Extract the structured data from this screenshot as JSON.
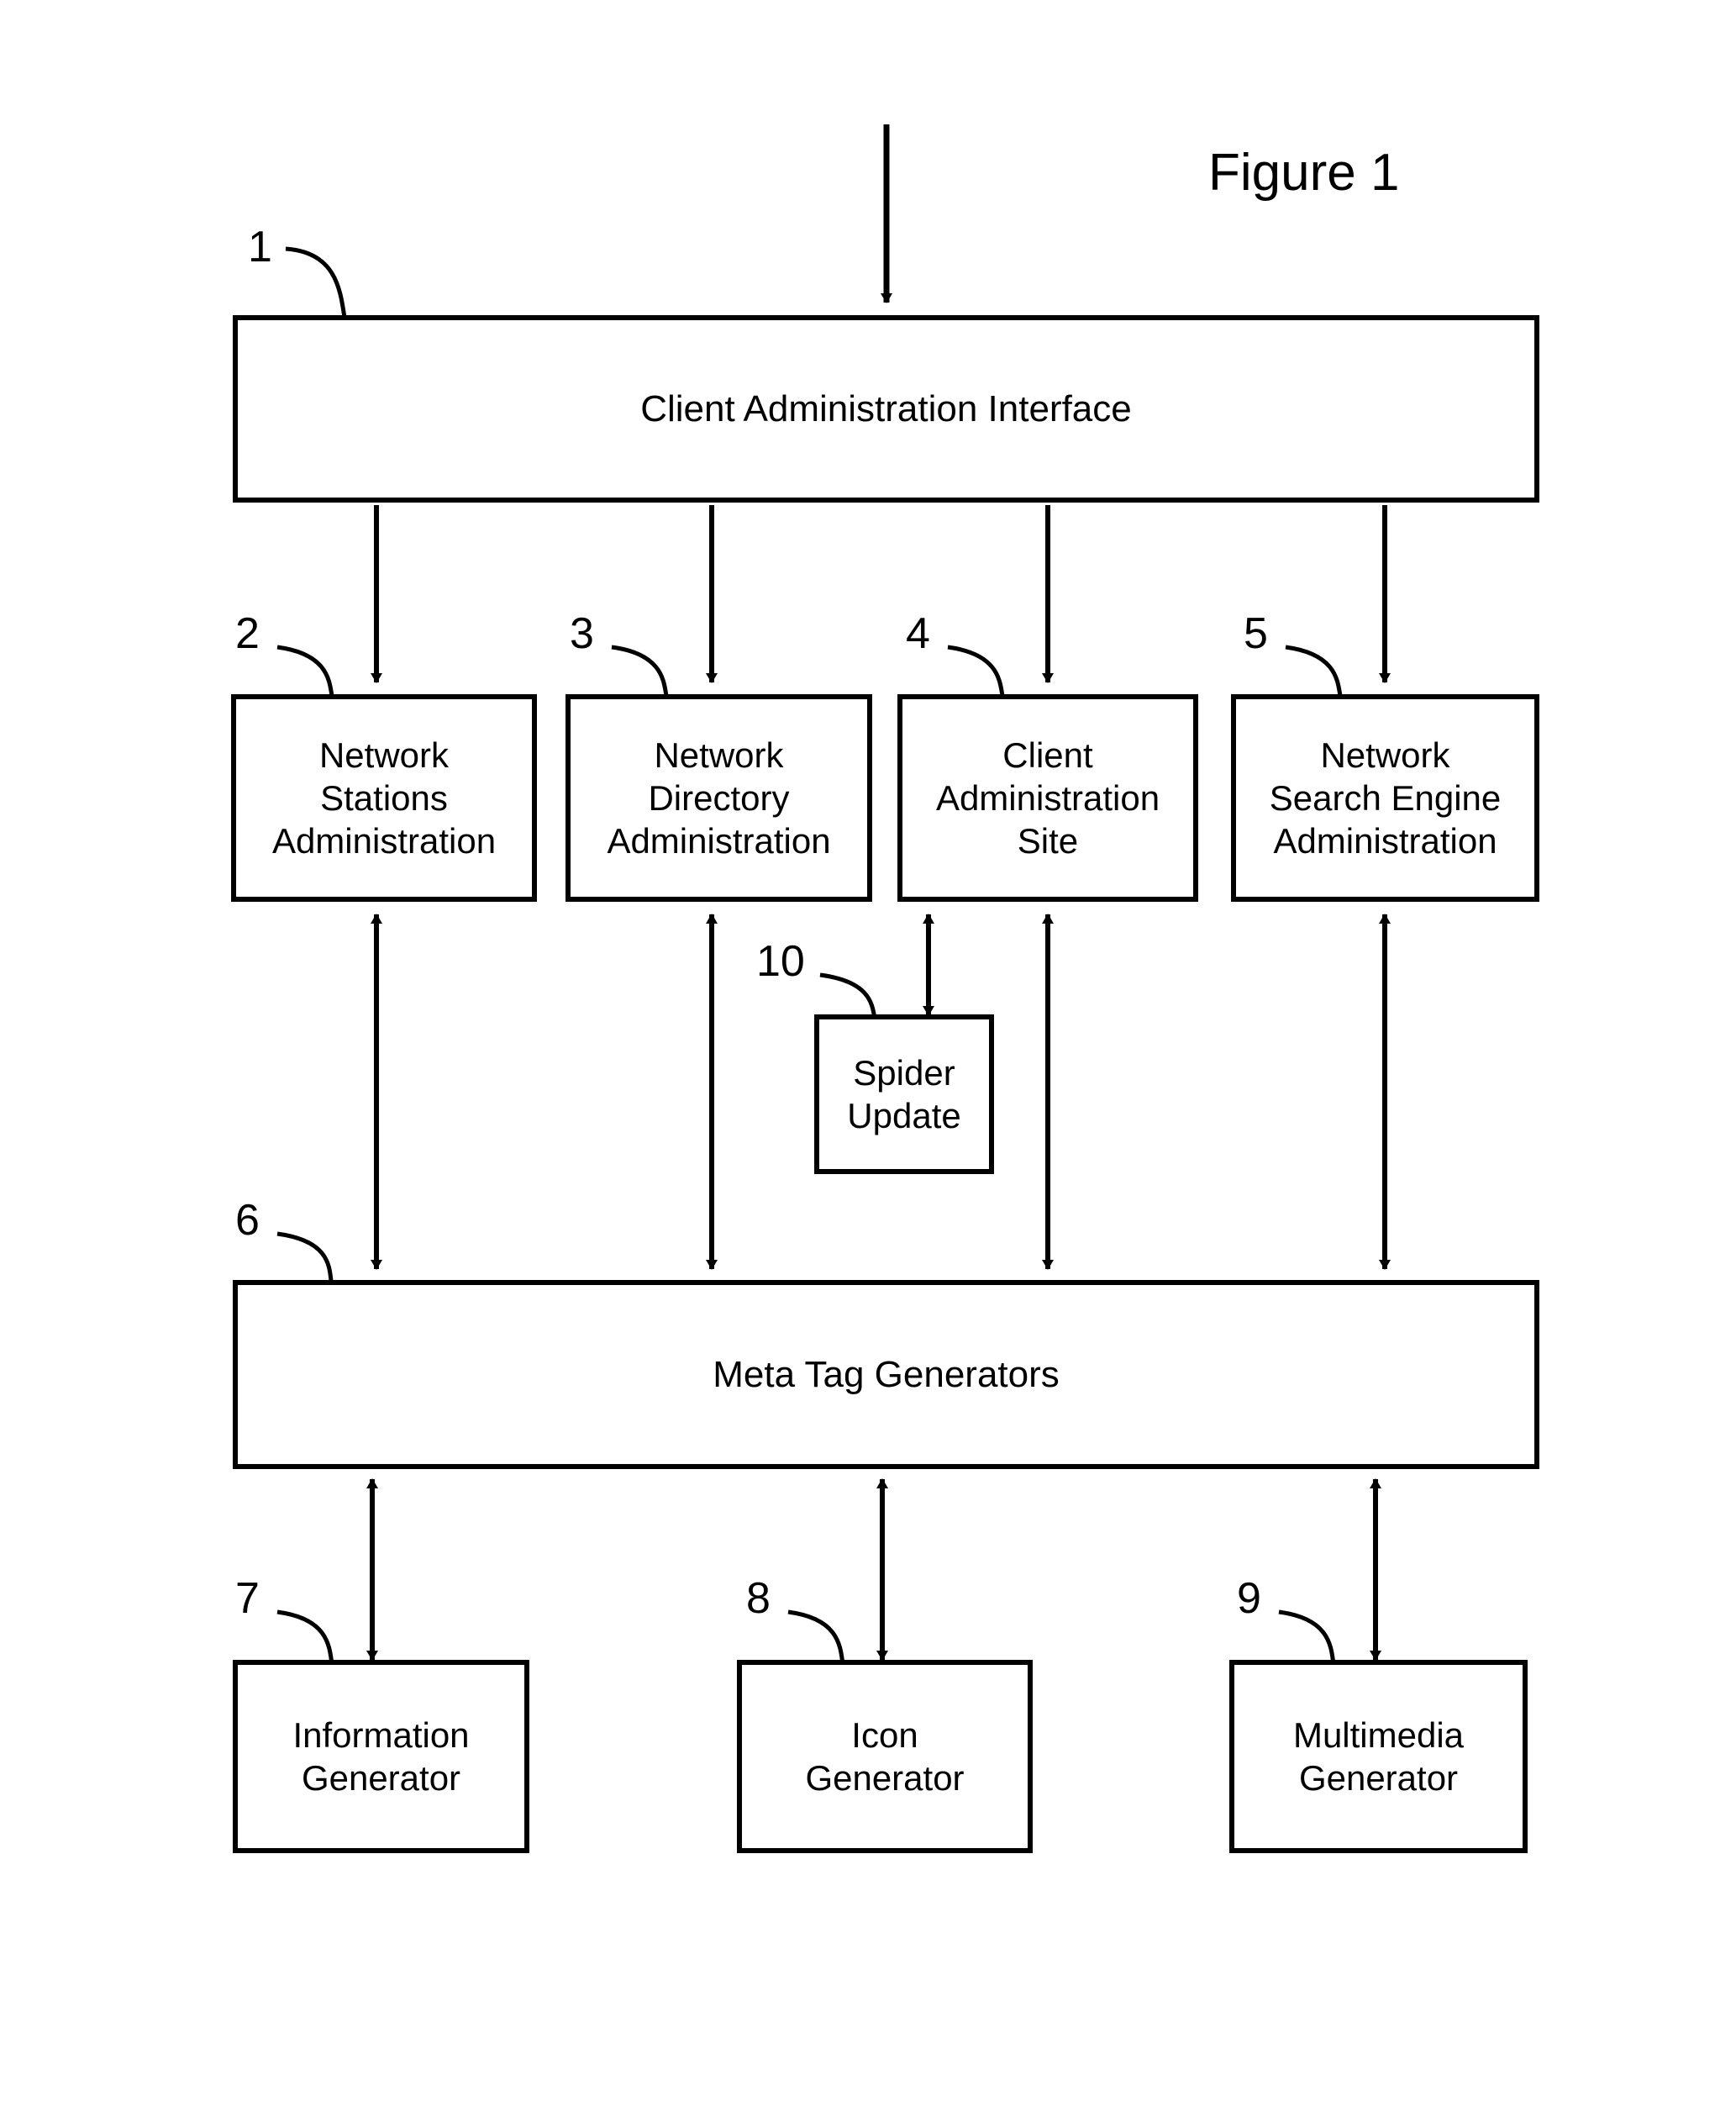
{
  "figure": {
    "title": "Figure 1"
  },
  "nodes": [
    {
      "ref": "1",
      "label": "Client Administration Interface",
      "name": "client-administration-interface"
    },
    {
      "ref": "2",
      "label": "Network\nStations\nAdministration",
      "name": "network-stations-administration"
    },
    {
      "ref": "3",
      "label": "Network\nDirectory\nAdministration",
      "name": "network-directory-administration"
    },
    {
      "ref": "4",
      "label": "Client\nAdministration\nSite",
      "name": "client-administration-site"
    },
    {
      "ref": "5",
      "label": "Network\nSearch Engine\nAdministration",
      "name": "network-search-engine-administration"
    },
    {
      "ref": "10",
      "label": "Spider\nUpdate",
      "name": "spider-update"
    },
    {
      "ref": "6",
      "label": "Meta Tag Generators",
      "name": "meta-tag-generators"
    },
    {
      "ref": "7",
      "label": "Information\nGenerator",
      "name": "information-generator"
    },
    {
      "ref": "8",
      "label": "Icon\nGenerator",
      "name": "icon-generator"
    },
    {
      "ref": "9",
      "label": "Multimedia\nGenerator",
      "name": "multimedia-generator"
    }
  ],
  "colors": {
    "stroke": "#000000",
    "background": "#ffffff",
    "text": "#000000"
  },
  "chart_data": {
    "type": "diagram",
    "title": "Figure 1",
    "blocks": [
      {
        "id": "1",
        "text": "Client Administration Interface"
      },
      {
        "id": "2",
        "text": "Network Stations Administration"
      },
      {
        "id": "3",
        "text": "Network Directory Administration"
      },
      {
        "id": "4",
        "text": "Client Administration Site"
      },
      {
        "id": "5",
        "text": "Network Search Engine Administration"
      },
      {
        "id": "6",
        "text": "Meta Tag Generators"
      },
      {
        "id": "7",
        "text": "Information Generator"
      },
      {
        "id": "8",
        "text": "Icon Generator"
      },
      {
        "id": "9",
        "text": "Multimedia Generator"
      },
      {
        "id": "10",
        "text": "Spider Update"
      }
    ],
    "edges": [
      {
        "from": "external-input",
        "to": "1",
        "style": "single-arrow-down"
      },
      {
        "from": "1",
        "to": "2",
        "style": "single-arrow-down"
      },
      {
        "from": "1",
        "to": "3",
        "style": "single-arrow-down"
      },
      {
        "from": "1",
        "to": "4",
        "style": "single-arrow-down"
      },
      {
        "from": "1",
        "to": "5",
        "style": "single-arrow-down"
      },
      {
        "from": "2",
        "to": "6",
        "style": "double-arrow"
      },
      {
        "from": "3",
        "to": "6",
        "style": "double-arrow"
      },
      {
        "from": "4",
        "to": "10",
        "style": "double-arrow"
      },
      {
        "from": "4",
        "to": "6",
        "style": "double-arrow"
      },
      {
        "from": "5",
        "to": "6",
        "style": "double-arrow"
      },
      {
        "from": "6",
        "to": "7",
        "style": "double-arrow"
      },
      {
        "from": "6",
        "to": "8",
        "style": "double-arrow"
      },
      {
        "from": "6",
        "to": "9",
        "style": "double-arrow"
      }
    ]
  }
}
